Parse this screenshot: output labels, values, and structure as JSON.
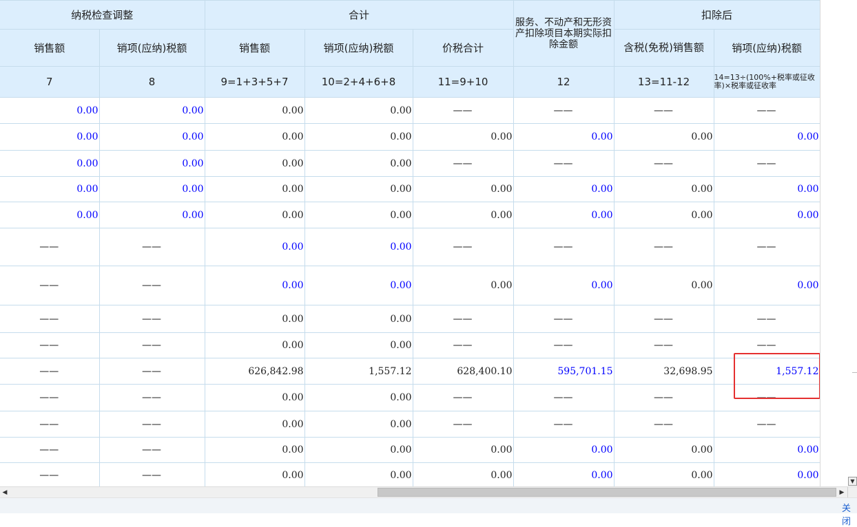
{
  "header": {
    "group1": "纳税检查调整",
    "group2": "合计",
    "group3": "服务、不动产和无形资产扣除项目本期实际扣除金额",
    "group4": "扣除后",
    "col_sales": "销售额",
    "col_tax": "销项(应纳)税额",
    "col_sales2": "销售额",
    "col_tax2": "销项(应纳)税额",
    "col_total": "价税合计",
    "col_taxincl": "含税(免税)销售额",
    "col_tax3": "销项(应纳)税额",
    "f7": "7",
    "f8": "8",
    "f9": "9=1+3+5+7",
    "f10": "10=2+4+6+8",
    "f11": "11=9+10",
    "f12": "12",
    "f13": "13=11-12",
    "f14": "14=13÷(100%+税率或征收率)×税率或征收率"
  },
  "rows": [
    {
      "c7": "0.00",
      "c8": "0.00",
      "c9": "0.00",
      "c10": "0.00",
      "c11": "——",
      "c12": "——",
      "c13": "——",
      "c14": "——"
    },
    {
      "c7": "0.00",
      "c8": "0.00",
      "c9": "0.00",
      "c10": "0.00",
      "c11": "0.00",
      "c12": "0.00",
      "c13": "0.00",
      "c14": "0.00"
    },
    {
      "c7": "0.00",
      "c8": "0.00",
      "c9": "0.00",
      "c10": "0.00",
      "c11": "——",
      "c12": "——",
      "c13": "——",
      "c14": "——"
    },
    {
      "c7": "0.00",
      "c8": "0.00",
      "c9": "0.00",
      "c10": "0.00",
      "c11": "0.00",
      "c12": "0.00",
      "c13": "0.00",
      "c14": "0.00"
    },
    {
      "c7": "0.00",
      "c8": "0.00",
      "c9": "0.00",
      "c10": "0.00",
      "c11": "0.00",
      "c12": "0.00",
      "c13": "0.00",
      "c14": "0.00"
    },
    {
      "c7": "——",
      "c8": "——",
      "c9": "0.00",
      "c10": "0.00",
      "c11": "——",
      "c12": "——",
      "c13": "——",
      "c14": "——"
    },
    {
      "c7": "——",
      "c8": "——",
      "c9": "0.00",
      "c10": "0.00",
      "c11": "0.00",
      "c12": "0.00",
      "c13": "0.00",
      "c14": "0.00"
    },
    {
      "c7": "——",
      "c8": "——",
      "c9": "0.00",
      "c10": "0.00",
      "c11": "——",
      "c12": "——",
      "c13": "——",
      "c14": "——"
    },
    {
      "c7": "——",
      "c8": "——",
      "c9": "0.00",
      "c10": "0.00",
      "c11": "——",
      "c12": "——",
      "c13": "——",
      "c14": "——"
    },
    {
      "c7": "——",
      "c8": "——",
      "c9": "626,842.98",
      "c10": "1,557.12",
      "c11": "628,400.10",
      "c12": "595,701.15",
      "c13": "32,698.95",
      "c14": "1,557.12"
    },
    {
      "c7": "——",
      "c8": "——",
      "c9": "0.00",
      "c10": "0.00",
      "c11": "——",
      "c12": "——",
      "c13": "——",
      "c14": "——"
    },
    {
      "c7": "——",
      "c8": "——",
      "c9": "0.00",
      "c10": "0.00",
      "c11": "——",
      "c12": "——",
      "c13": "——",
      "c14": "——"
    },
    {
      "c7": "——",
      "c8": "——",
      "c9": "0.00",
      "c10": "0.00",
      "c11": "0.00",
      "c12": "0.00",
      "c13": "0.00",
      "c14": "0.00"
    },
    {
      "c7": "——",
      "c8": "——",
      "c9": "0.00",
      "c10": "0.00",
      "c11": "0.00",
      "c12": "0.00",
      "c13": "0.00",
      "c14": "0.00"
    }
  ],
  "footer": {
    "close_label": "关闭"
  },
  "colors": {
    "header_bg": "#dceefd",
    "border": "#c5dcec",
    "editable_text": "#0000ff",
    "highlight": "#e53030"
  }
}
